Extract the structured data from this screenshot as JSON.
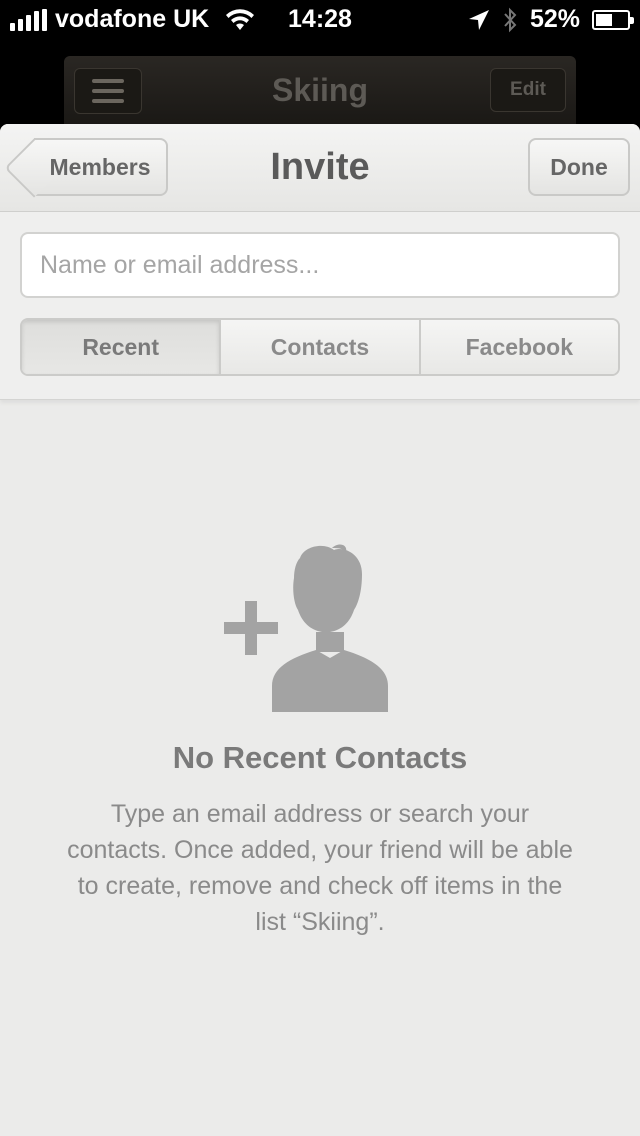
{
  "status_bar": {
    "carrier": "vodafone UK",
    "time": "14:28",
    "battery": "52%",
    "battery_level": 0.52,
    "icons": [
      "signal-icon",
      "wifi-icon",
      "location-icon",
      "bluetooth-icon",
      "battery-icon"
    ]
  },
  "background_screen": {
    "title": "Skiing",
    "edit_label": "Edit",
    "menu_icon": "menu-icon"
  },
  "navbar": {
    "back_label": "Members",
    "title": "Invite",
    "done_label": "Done"
  },
  "search": {
    "value": "",
    "placeholder": "Name or email address..."
  },
  "segments": {
    "items": [
      {
        "label": "Recent",
        "selected": true
      },
      {
        "label": "Contacts",
        "selected": false
      },
      {
        "label": "Facebook",
        "selected": false
      }
    ]
  },
  "empty_state": {
    "icon": "add-person-icon",
    "title": "No Recent Contacts",
    "message": "Type an email address or search your contacts. Once added, your friend will be able to create, remove and check off items in the list “Skiing”."
  },
  "colors": {
    "sheet_background": "#ebebea",
    "text_gray": "#7a7a7a",
    "icon_gray": "#a3a3a3"
  }
}
